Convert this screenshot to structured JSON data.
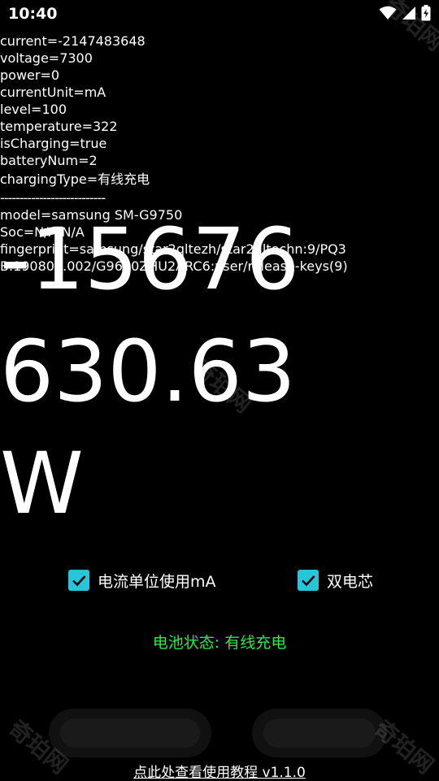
{
  "status_bar": {
    "time": "10:40",
    "icons": [
      "wifi-icon",
      "cell-signal-icon",
      "battery-charging-icon"
    ]
  },
  "info": {
    "current": "current=-2147483648",
    "voltage": "voltage=7300",
    "power": "power=0",
    "current_unit": "currentUnit=mA",
    "level": "level=100",
    "temperature": "temperature=322",
    "is_charging": "isCharging=true",
    "battery_num": "batteryNum=2",
    "charging_type": "chargingType=有线充电",
    "divider": "------------------------------------------",
    "model": "model=samsung SM-G9750",
    "soc": "Soc=N/A N/A",
    "fingerprint": "fingerprint=samsung/star2qltezh/star2qltechn:9/PQ3B.190801.002/G9650ZHU2ARC6:user/release-keys(9)"
  },
  "readout": {
    "line1": "-15676",
    "line2": "630.63",
    "line3": "W"
  },
  "options": {
    "unit_ma_label": "电流单位使用mA",
    "unit_ma_checked": true,
    "dual_cell_label": "双电芯",
    "dual_cell_checked": true
  },
  "battery_status": "电池状态: 有线充电",
  "tutorial_link": "点此处查看使用教程  v1.1.0",
  "watermark": "奇珀网",
  "colors": {
    "background": "#000000",
    "text": "#ffffff",
    "checkbox": "#26c6da",
    "status_green": "#2ee84a"
  }
}
